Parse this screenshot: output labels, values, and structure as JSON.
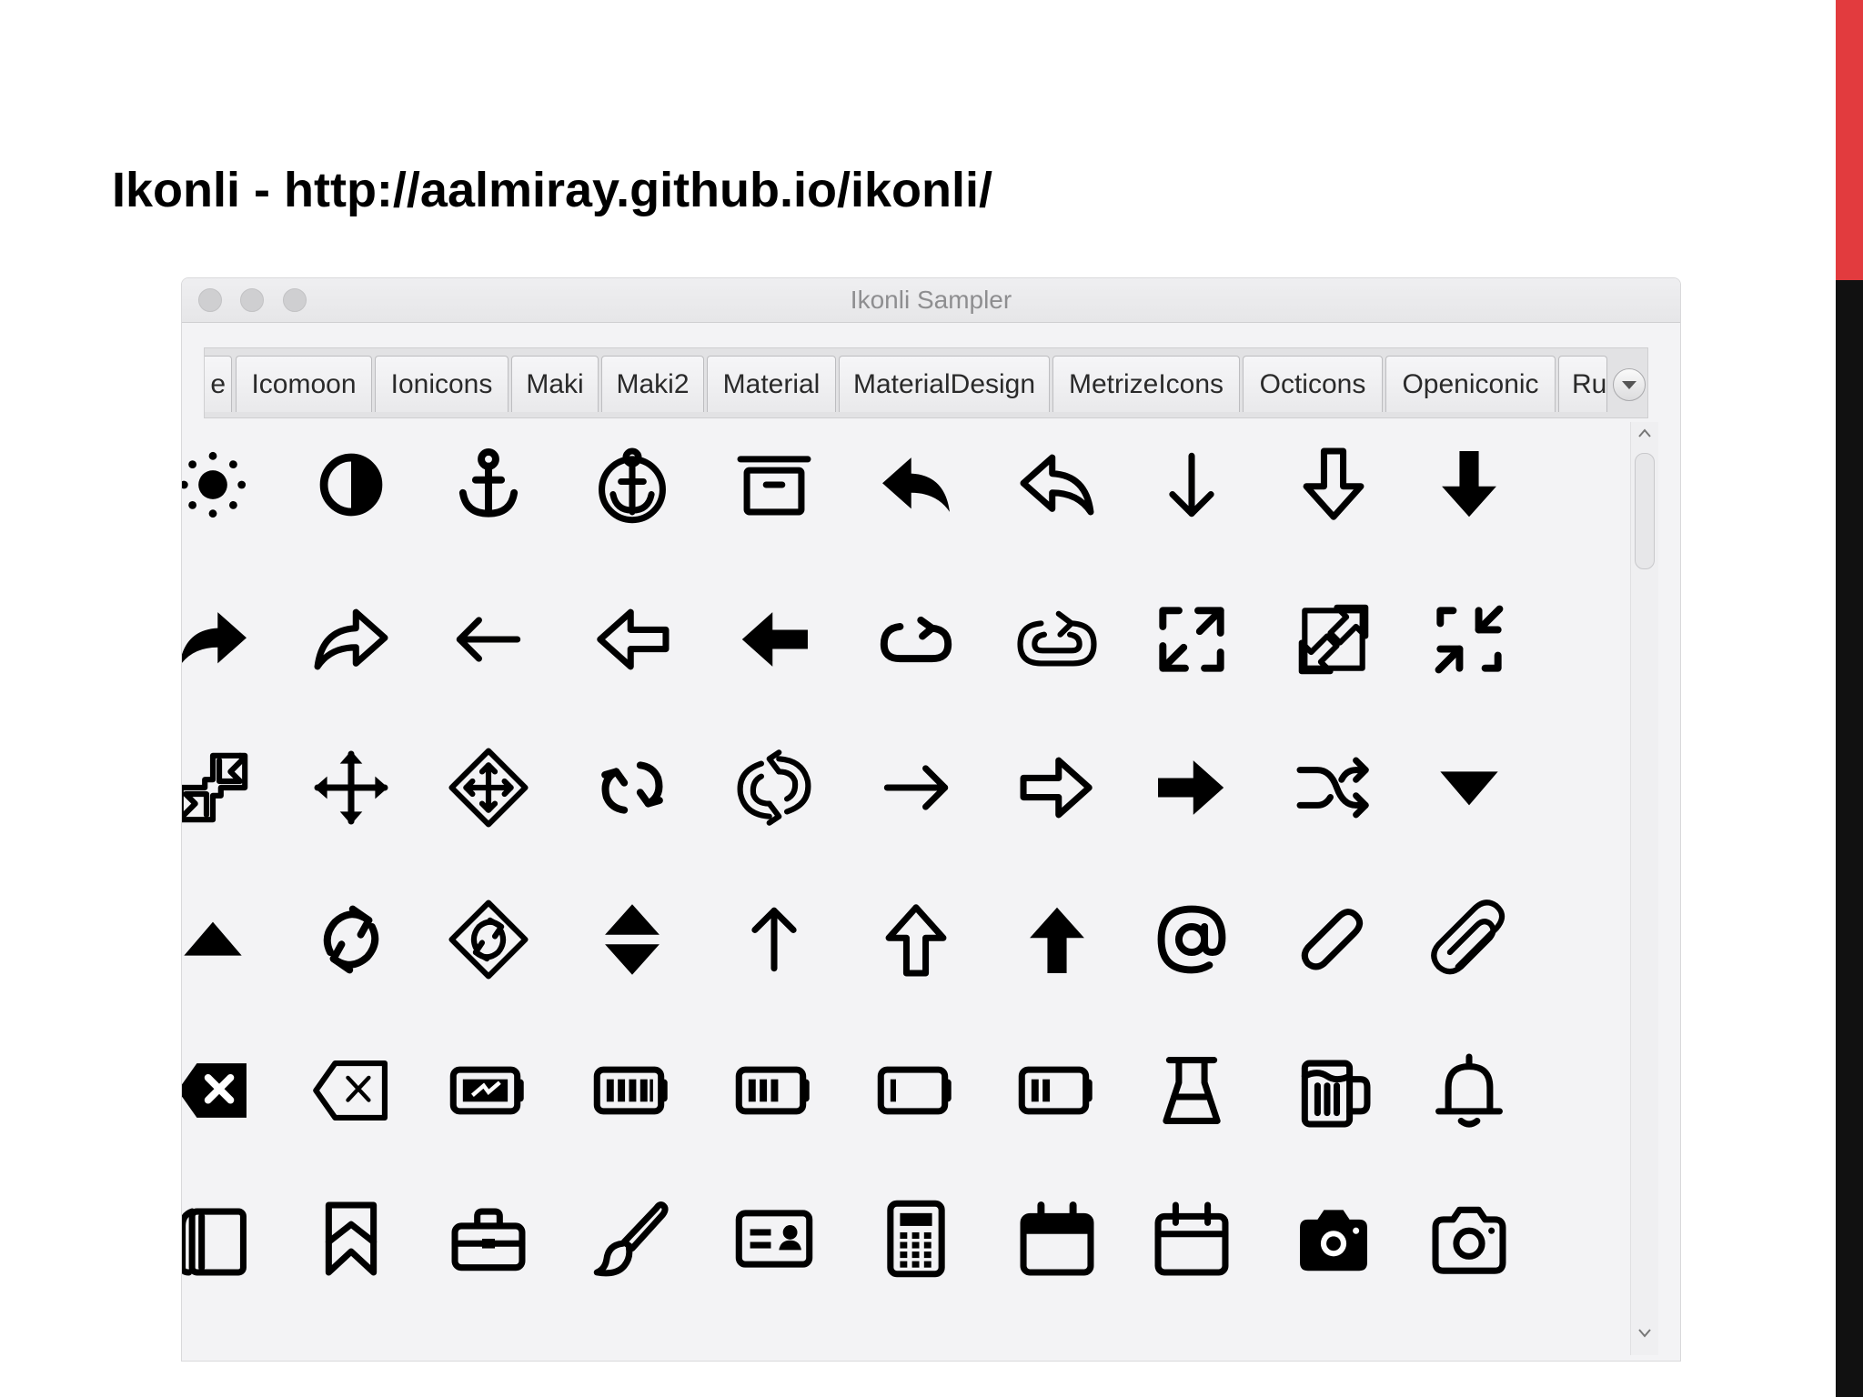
{
  "slide": {
    "title": "Ikonli - http://aalmiray.github.io/ikonli/"
  },
  "window": {
    "title": "Ikonli Sampler"
  },
  "tabs": [
    {
      "label": "e"
    },
    {
      "label": "Icomoon"
    },
    {
      "label": "Ionicons"
    },
    {
      "label": "Maki"
    },
    {
      "label": "Maki2"
    },
    {
      "label": "Material"
    },
    {
      "label": "MaterialDesign"
    },
    {
      "label": "MetrizeIcons"
    },
    {
      "label": "Octicons"
    },
    {
      "label": "Openiconic"
    },
    {
      "label": "Ru"
    }
  ],
  "icons": [
    [
      "sun-icon",
      "contrast-icon",
      "anchor-icon",
      "anchor-circle-icon",
      "archive-icon",
      "reply-filled-icon",
      "reply-outline-icon",
      "arrow-down-thin-icon",
      "arrow-down-outline-icon",
      "arrow-down-bold-icon"
    ],
    [
      "forward-filled-icon",
      "forward-outline-icon",
      "arrow-left-thin-icon",
      "arrow-left-outline-icon",
      "arrow-left-bold-icon",
      "loop-icon",
      "loop-outline-icon",
      "expand-arrows-icon",
      "expand-arrows-outline-icon",
      "collapse-arrows-icon"
    ],
    [
      "collapse-arrows-outline-icon",
      "move-icon",
      "move-outline-icon",
      "repeat-icon",
      "repeat-outline-icon",
      "arrow-right-thin-icon",
      "arrow-right-outline-icon",
      "arrow-right-bold-icon",
      "shuffle-icon",
      "triangle-down-icon"
    ],
    [
      "triangle-up-icon",
      "sync-icon",
      "sync-outline-icon",
      "unsorted-icon",
      "arrow-up-thin-icon",
      "arrow-up-outline-icon",
      "arrow-up-bold-icon",
      "at-icon",
      "attachment-icon",
      "attachment-outline-icon"
    ],
    [
      "backspace-filled-icon",
      "backspace-outline-icon",
      "battery-charge-icon",
      "battery-full-icon",
      "battery-high-icon",
      "battery-low-icon",
      "battery-mid-icon",
      "beaker-icon",
      "beer-icon",
      "bell-icon"
    ],
    [
      "book-icon",
      "bookmark-icon",
      "briefcase-icon",
      "brush-icon",
      "business-card-icon",
      "calculator-icon",
      "calendar-icon",
      "calendar-outline-icon",
      "camera-icon",
      "camera-outline-icon"
    ]
  ]
}
